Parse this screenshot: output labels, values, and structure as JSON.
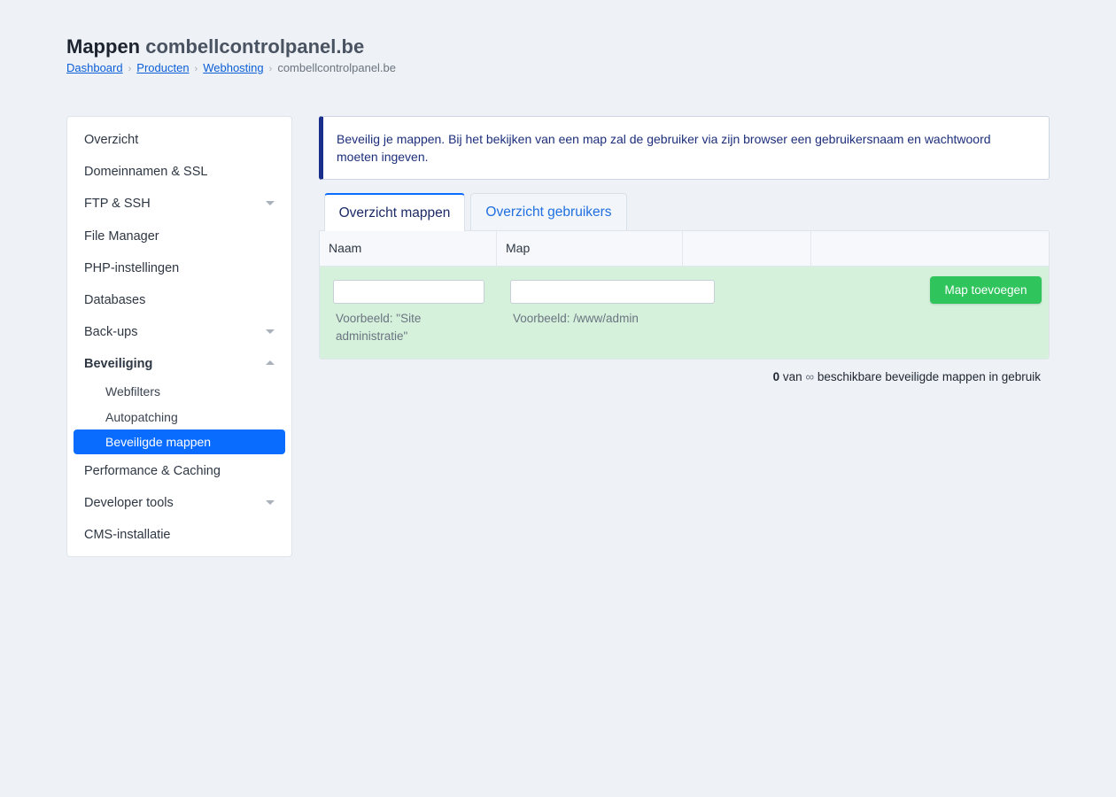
{
  "header": {
    "title_strong": "Mappen",
    "title_light": "combellcontrolpanel.be",
    "breadcrumb": [
      {
        "label": "Dashboard"
      },
      {
        "label": "Producten"
      },
      {
        "label": "Webhosting"
      },
      {
        "label": "combellcontrolpanel.be"
      }
    ],
    "breadcrumb_separator": "›"
  },
  "sidebar": {
    "items": [
      {
        "label": "Overzicht"
      },
      {
        "label": "Domeinnamen & SSL"
      },
      {
        "label": "FTP & SSH",
        "icon": "chevron-down-icon"
      },
      {
        "label": "File Manager"
      },
      {
        "label": "PHP-instellingen"
      },
      {
        "label": "Databases"
      },
      {
        "label": "Back-ups",
        "icon": "chevron-down-icon"
      },
      {
        "label": "Beveiliging",
        "icon": "chevron-up-icon",
        "expanded": true
      },
      {
        "label": "Performance & Caching"
      },
      {
        "label": "Developer tools",
        "icon": "chevron-down-icon"
      },
      {
        "label": "CMS-installatie"
      }
    ],
    "sub_items": [
      {
        "label": "Webfilters"
      },
      {
        "label": "Autopatching"
      },
      {
        "label": "Beveiligde mappen",
        "active": true
      }
    ]
  },
  "info": {
    "text": "Beveilig je mappen. Bij het bekijken van een map zal de gebruiker via zijn browser een gebruikersnaam en wachtwoord moeten ingeven."
  },
  "tabs": [
    {
      "label": "Overzicht mappen",
      "active": true
    },
    {
      "label": "Overzicht gebruikers",
      "active": false
    }
  ],
  "table": {
    "columns": [
      "Naam",
      "Map",
      "",
      ""
    ],
    "naam_input": {
      "value": "",
      "hint": "Voorbeeld: \"Site administratie\""
    },
    "map_input": {
      "value": "",
      "hint": "Voorbeeld: /www/admin"
    },
    "add_button": "Map toevoegen"
  },
  "usage": {
    "count": "0",
    "text_1": "van",
    "limit": "∞",
    "text_2": "beschikbare beveiligde mappen in gebruik"
  },
  "colors": {
    "accent": "#0a6cff",
    "success": "#2fc45c",
    "info_border": "#1a2e8c",
    "green_row": "#d5f1dc"
  }
}
